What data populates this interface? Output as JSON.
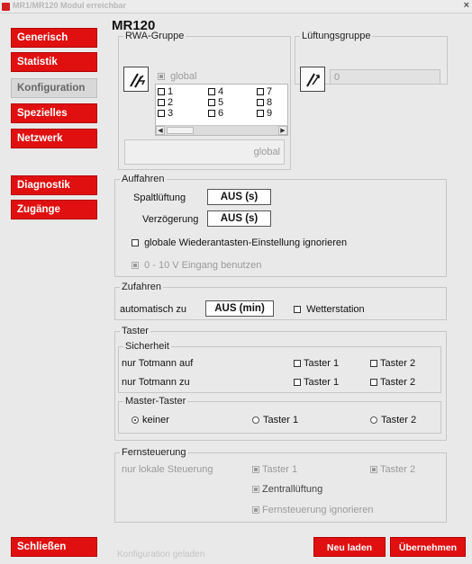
{
  "window": {
    "title": "MR1/MR120 Modul erreichbar",
    "close_glyph": "×"
  },
  "nav": {
    "items": [
      {
        "label": "Generisch"
      },
      {
        "label": "Statistik"
      },
      {
        "label": "Konfiguration",
        "active": true
      },
      {
        "label": "Spezielles"
      },
      {
        "label": "Netzwerk"
      },
      {
        "label": "Diagnostik"
      },
      {
        "label": "Zugänge"
      }
    ],
    "close_label": "Schließen"
  },
  "page": {
    "title": "MR120"
  },
  "rwa": {
    "legend": "RWA-Gruppe",
    "global_label": "global",
    "groups": [
      "1",
      "2",
      "3",
      "4",
      "5",
      "6",
      "7",
      "8",
      "9"
    ],
    "scroll_left": "◀",
    "scroll_right": "▶",
    "summary": "global"
  },
  "lueftung": {
    "legend": "Lüftungsgruppe",
    "value": "0"
  },
  "auffahren": {
    "legend": "Auffahren",
    "spaltlueftung_label": "Spaltlüftung",
    "spaltlueftung_value": "AUS (s)",
    "verzoegerung_label": "Verzögerung",
    "verzoegerung_value": "AUS (s)",
    "wiederantasten_label": "globale Wiederantasten-Einstellung ignorieren",
    "eingang_label": "0 - 10 V Eingang benutzen"
  },
  "zufahren": {
    "legend": "Zufahren",
    "auto_label": "automatisch zu",
    "auto_value": "AUS (min)",
    "wetter_label": "Wetterstation"
  },
  "taster": {
    "legend": "Taster",
    "sicherheit": {
      "legend": "Sicherheit",
      "rows": [
        {
          "label": "nur Totmann auf",
          "t1": "Taster 1",
          "t2": "Taster 2"
        },
        {
          "label": "nur Totmann zu",
          "t1": "Taster 1",
          "t2": "Taster 2"
        }
      ]
    },
    "master": {
      "legend": "Master-Taster",
      "options": [
        "keiner",
        "Taster 1",
        "Taster 2"
      ],
      "selected": "keiner"
    }
  },
  "fern": {
    "legend": "Fernsteuerung",
    "lokal_label": "nur lokale Steuerung",
    "taster1": "Taster 1",
    "taster2": "Taster 2",
    "zentral": "Zentrallüftung",
    "ignore": "Fernsteuerung ignorieren"
  },
  "status": {
    "text": "Konfiguration geladen"
  },
  "buttons": {
    "reload": "Neu laden",
    "apply": "Übernehmen"
  },
  "colors": {
    "accent": "#e01010",
    "background": "#e9e9e9"
  }
}
